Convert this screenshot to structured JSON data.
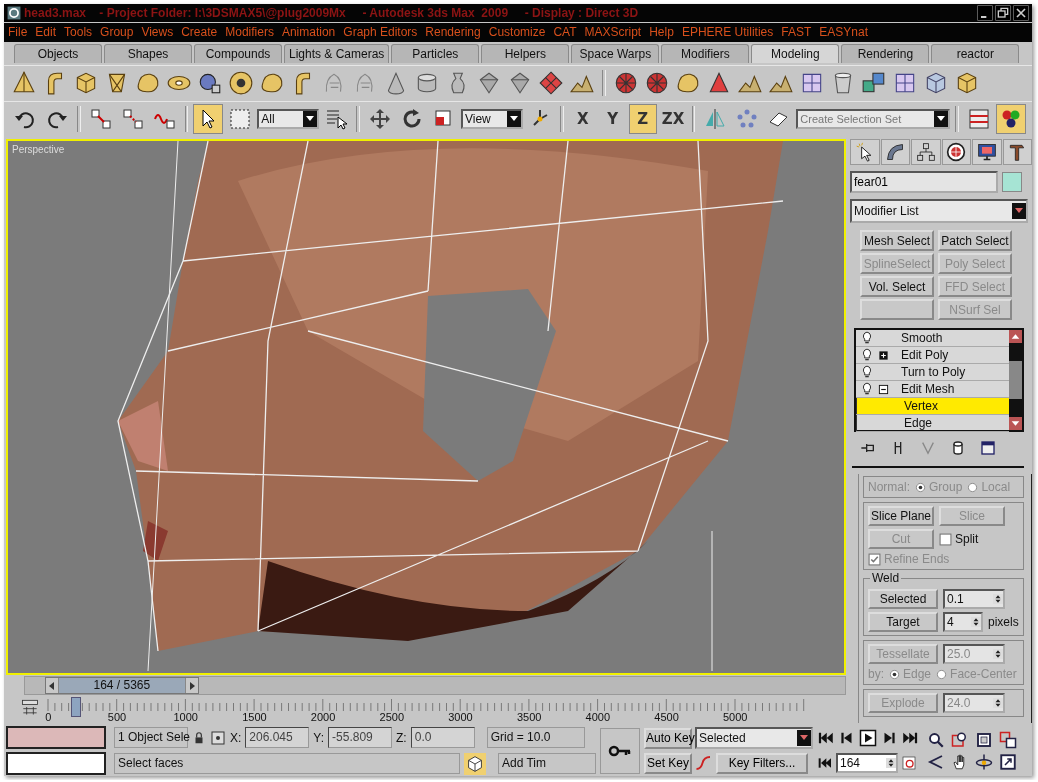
{
  "window": {
    "title": "head3.max    - Project Folder: I:\\3DSMAX5\\@plug2009Mx     - Autodesk 3ds Max  2009     - Display : Direct 3D"
  },
  "menu": [
    "File",
    "Edit",
    "Tools",
    "Group",
    "Views",
    "Create",
    "Modifiers",
    "Animation",
    "Graph Editors",
    "Rendering",
    "Customize",
    "CAT",
    "MAXScript",
    "Help",
    "EPHERE Utilities",
    "FAST",
    "EASYnat"
  ],
  "tabs": [
    {
      "label": "Objects",
      "selected": false
    },
    {
      "label": "Shapes",
      "selected": false
    },
    {
      "label": "Compounds",
      "selected": false
    },
    {
      "label": "Lights & Cameras",
      "selected": false
    },
    {
      "label": "Particles",
      "selected": false
    },
    {
      "label": "Helpers",
      "selected": false
    },
    {
      "label": "Space Warps",
      "selected": false
    },
    {
      "label": "Modifiers",
      "selected": false
    },
    {
      "label": "Modeling",
      "selected": true
    },
    {
      "label": "Rendering",
      "selected": false
    },
    {
      "label": "reactor",
      "selected": false
    }
  ],
  "main_toolbar": [
    [
      {
        "kind": "tool",
        "selected": false
      },
      {
        "kind": "tool",
        "selected": false
      }
    ],
    [
      {
        "kind": "tool",
        "selected": false
      },
      {
        "kind": "tool",
        "selected": false
      },
      {
        "kind": "tool",
        "selected": false
      }
    ],
    [
      {
        "kind": "tool",
        "selected": true
      },
      {
        "kind": "tool",
        "selected": false
      },
      {
        "kind": "dropdown",
        "value": "All"
      },
      {
        "kind": "tool",
        "selected": false
      }
    ],
    [
      {
        "kind": "tool",
        "selected": false
      },
      {
        "kind": "tool",
        "selected": false
      },
      {
        "kind": "tool",
        "selected": false
      },
      {
        "kind": "dropdown",
        "value": "View"
      },
      {
        "kind": "tool",
        "selected": false
      }
    ],
    [
      {
        "kind": "axis",
        "label": "X",
        "selected": false
      },
      {
        "kind": "axis",
        "label": "Y",
        "selected": false
      },
      {
        "kind": "axis",
        "label": "Z",
        "selected": true
      },
      {
        "kind": "axis",
        "label": "ZX",
        "selected": false
      }
    ],
    [
      {
        "kind": "tool",
        "selected": false
      },
      {
        "kind": "tool",
        "selected": false
      },
      {
        "kind": "tool",
        "selected": false
      },
      {
        "kind": "combo",
        "placeholder": "Create Selection Set"
      }
    ],
    [
      {
        "kind": "tool",
        "selected": false
      },
      {
        "kind": "tool",
        "selected": true
      }
    ]
  ],
  "viewport": {
    "label": "Perspective",
    "active": true
  },
  "command_panel": {
    "object_name": "fear01",
    "modifier_list": "Modifier List",
    "modifier_buttons": [
      {
        "kind": "button",
        "label": "Mesh Select",
        "disabled": false
      },
      {
        "kind": "button",
        "label": "Patch Select",
        "disabled": false
      },
      {
        "kind": "button",
        "label": "SplineSelect",
        "disabled": true
      },
      {
        "kind": "button",
        "label": "Poly Select",
        "disabled": true
      },
      {
        "kind": "button",
        "label": "Vol. Select",
        "disabled": false
      },
      {
        "kind": "button",
        "label": "FFD Select",
        "disabled": true
      },
      {
        "kind": "blank"
      },
      {
        "kind": "button",
        "label": "NSurf Sel",
        "disabled": true
      }
    ],
    "stack": [
      {
        "kind": "plain",
        "label": "Smooth",
        "selected": false
      },
      {
        "kind": "group",
        "label": "Edit Poly",
        "expanded": false,
        "selected": false
      },
      {
        "kind": "plain",
        "label": "Turn to Poly",
        "selected": false
      },
      {
        "kind": "group",
        "label": "Edit Mesh",
        "expanded": true,
        "selected": false,
        "children": [
          {
            "label": "Vertex",
            "selected": true
          },
          {
            "label": "Edge",
            "selected": false
          }
        ]
      }
    ],
    "rollout": {
      "normal": {
        "label": "Normal:",
        "disabled": true,
        "options": [
          {
            "label": "Group",
            "selected": true
          },
          {
            "label": "Local",
            "selected": false
          }
        ]
      },
      "slice_plane": {
        "label": "Slice Plane",
        "disabled": false
      },
      "slice": {
        "label": "Slice",
        "disabled": true
      },
      "cut": {
        "label": "Cut",
        "disabled": true
      },
      "split": {
        "label": "Split",
        "checked": false,
        "disabled": false
      },
      "refine_ends": {
        "label": "Refine Ends",
        "checked": true,
        "disabled": true
      },
      "weld": {
        "title": "Weld",
        "selected_button": "Selected",
        "selected_value": "0.1",
        "target_button": "Target",
        "target_value": "4",
        "unit": "pixels"
      },
      "tessellate": {
        "label": "Tessellate",
        "value": "25.0",
        "disabled": true
      },
      "by": {
        "label": "by:",
        "disabled": true,
        "options": [
          {
            "label": "Edge",
            "selected": true
          },
          {
            "label": "Face-Center",
            "selected": false
          }
        ]
      },
      "explode": {
        "label": "Explode",
        "value": "24.0",
        "disabled": true
      }
    }
  },
  "time_slider": {
    "label": "164 / 5365",
    "level": 0.031
  },
  "track_bar": {
    "ticks": [
      "0",
      "500",
      "1000",
      "1500",
      "2000",
      "2500",
      "3000",
      "3500",
      "4000",
      "4500",
      "5000"
    ]
  },
  "status_bar": {
    "selection": "1 Object Sele",
    "coords": [
      {
        "label": "X:",
        "value": "206.045"
      },
      {
        "label": "Y:",
        "value": "-55.809"
      },
      {
        "label": "Z:",
        "value": "0.0"
      }
    ],
    "grid": "Grid = 10.0",
    "prompt": "Select faces",
    "add_time": "Add Tim",
    "auto_key": {
      "label": "Auto Key",
      "on": false
    },
    "key_mode": "Selected",
    "set_key": "Set Key",
    "key_filters": "Key Filters...",
    "frame": "164"
  }
}
